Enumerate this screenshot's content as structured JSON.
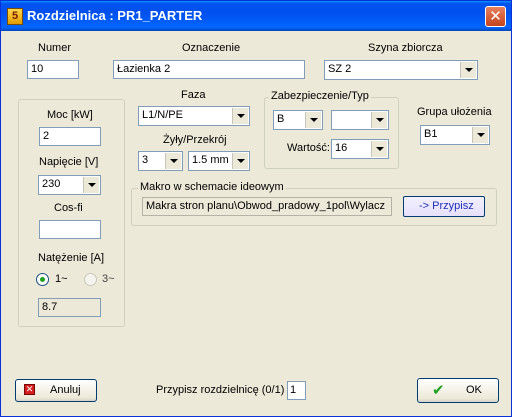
{
  "window": {
    "title": "Rozdzielnica : PR1_PARTER"
  },
  "header": {
    "numer_label": "Numer",
    "numer_value": "10",
    "oznaczenie_label": "Oznaczenie",
    "oznaczenie_value": "Łazienka 2",
    "szyna_label": "Szyna zbiorcza",
    "szyna_value": "SZ 2"
  },
  "left_panel": {
    "moc_label": "Moc [kW]",
    "moc_value": "2",
    "napiecie_label": "Napięcie [V]",
    "napiecie_value": "230",
    "cosfi_label": "Cos-fi",
    "cosfi_value": "",
    "natezenie_label": "Natężenie [A]",
    "phase1_label": "1~",
    "phase3_label": "3~",
    "phase1_checked": true,
    "natezenie_value": "8.7"
  },
  "faza": {
    "label": "Faza",
    "value": "L1/N/PE"
  },
  "zyly": {
    "label": "Żyły/Przekrój",
    "count_value": "3",
    "section_value": "1.5 mm"
  },
  "zabezpieczenie": {
    "title": "Zabezpieczenie/Typ",
    "type_value": "B",
    "second_value": "",
    "wartosc_label": "Wartość:",
    "wartosc_value": "16"
  },
  "grupa": {
    "label": "Grupa ułożenia",
    "value": "B1"
  },
  "makro": {
    "title": "Makro w schemacie ideowym",
    "path_value": "Makra stron planu\\Obwod_pradowy_1pol\\Wylacz",
    "assign_button": "-> Przypisz"
  },
  "footer": {
    "cancel_label": "Anuluj",
    "przypisz_label": "Przypisz rozdzielnicę (0/1) :",
    "przypisz_value": "1",
    "ok_label": "OK"
  },
  "colors": {
    "titlebar": "#0053ee",
    "dialog_bg": "#ece9d8",
    "field_border": "#7f9db9",
    "ok_check": "#21a121",
    "cancel_icon": "#d42020"
  }
}
